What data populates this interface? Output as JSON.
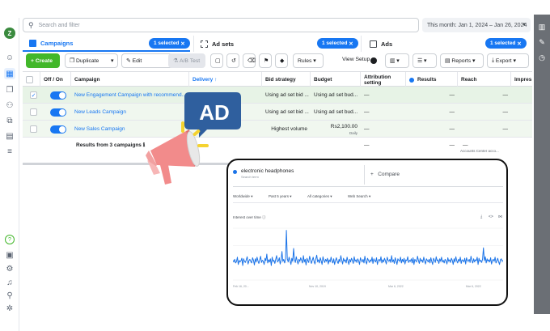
{
  "leftbar": {
    "avatar_initial": "Z",
    "icons": [
      "face-icon",
      "table-icon",
      "pages-icon",
      "people-icon",
      "stack-icon",
      "library-icon",
      "menu-icon",
      "help-icon",
      "image-icon",
      "settings-icon",
      "bell-icon",
      "search-icon",
      "bug-icon"
    ]
  },
  "rightbar": {
    "icons": [
      "chart-icon",
      "pencil-icon",
      "clock-icon"
    ]
  },
  "topbar": {
    "search_placeholder": "Search and filter",
    "date_range": "This month: Jan 1, 2024 – Jan 26, 2024"
  },
  "tabs": [
    {
      "label": "Campaigns",
      "badge": "1 selected",
      "active": true
    },
    {
      "label": "Ad sets",
      "badge": "1 selected",
      "active": false
    },
    {
      "label": "Ads",
      "badge": "1 selected",
      "active": false
    }
  ],
  "toolbar": {
    "create": "Create",
    "duplicate": "Duplicate",
    "edit": "Edit",
    "ab_test": "A/B Test",
    "rules": "Rules",
    "view_setup": "View Setup",
    "reports": "Reports",
    "export": "Export"
  },
  "table": {
    "headers": {
      "offon": "Off / On",
      "campaign": "Campaign",
      "delivery": "Delivery ↑",
      "bid": "Bid strategy",
      "budget": "Budget",
      "attribution": "Attribution setting",
      "results": "Results",
      "reach": "Reach",
      "impressions": "Impres"
    },
    "rows": [
      {
        "campaign": "New Engagement Campaign with recommend...",
        "bid": "Using ad set bid ...",
        "budget": "Using ad set bud...",
        "attribution": "—",
        "results": "—",
        "results_dash": "—",
        "reach": "—",
        "selected": true
      },
      {
        "campaign": "New Leads Campaign",
        "bid": "Using ad set bid ...",
        "budget": "Using ad set bud...",
        "attribution": "—",
        "results": "—",
        "results_dash": "—",
        "reach": "—",
        "selected": false
      },
      {
        "campaign": "New Sales Campaign",
        "bid": "Highest volume",
        "budget": "Rs2,100.00",
        "budget_sub": "Daily",
        "attribution": "—",
        "results": "—",
        "results_dash": "—",
        "reach": "—",
        "selected": false
      }
    ],
    "summary": {
      "label": "Results from 3 campaigns",
      "attribution": "—",
      "results": "—",
      "reach": "—",
      "reach_sub": "Accounts Center acco..."
    }
  },
  "promo": {
    "badge_text": "AD"
  },
  "trends": {
    "term": "electronic headphones",
    "term_sub": "Search term",
    "compare": "Compare",
    "filters": [
      "Worldwide",
      "Past 5 years",
      "All categories",
      "Web Search"
    ],
    "section_title": "Interest over time",
    "x_labels": [
      "Feb 16, 20...",
      "Nov 10, 2019",
      "Mar 6, 2022",
      "Mar 6, 2022"
    ],
    "chart_data": {
      "type": "line",
      "title": "Interest over time",
      "series": [
        {
          "values": [
            38,
            35,
            40,
            33,
            36,
            44,
            30,
            38,
            35,
            37,
            42,
            28,
            41,
            36,
            34,
            39,
            45,
            31,
            37,
            40,
            36,
            33,
            43,
            38,
            29,
            41,
            35,
            44,
            37,
            32,
            39,
            46,
            34,
            38,
            36,
            30,
            42,
            37,
            50,
            33,
            39,
            35,
            41,
            28,
            44,
            36,
            38,
            32,
            40,
            47,
            35,
            37,
            43,
            31,
            38,
            55,
            36,
            40,
            33,
            39,
            96,
            41,
            35,
            44,
            38,
            30,
            42,
            36,
            61,
            39,
            34,
            45,
            37,
            31,
            40,
            36,
            43,
            38,
            33,
            47,
            35,
            40,
            29,
            42,
            37,
            34,
            46,
            39,
            32,
            38,
            44,
            36,
            31,
            41,
            48,
            35,
            39,
            33,
            43,
            37,
            30,
            45,
            38,
            34,
            40,
            36,
            42,
            31,
            39,
            35,
            44,
            37,
            33,
            41,
            30,
            38,
            43,
            36,
            32,
            40,
            35,
            47,
            38,
            31,
            42,
            36,
            39,
            33,
            44,
            37,
            30,
            40,
            35,
            42,
            38,
            32,
            45,
            36,
            39,
            34,
            41,
            37,
            30,
            43,
            38,
            35,
            40,
            33,
            46,
            36,
            31,
            42,
            38,
            34,
            39,
            36,
            44,
            32,
            41,
            37,
            35,
            43,
            30,
            38,
            40,
            36,
            45,
            33,
            39,
            35,
            42,
            37,
            31,
            44,
            38,
            36,
            40,
            34,
            47,
            35,
            39,
            32,
            43,
            37,
            30,
            41,
            38,
            36,
            44,
            33,
            40,
            35,
            42,
            31,
            39,
            37,
            45,
            34,
            38,
            36,
            41,
            33,
            43,
            30,
            40,
            37,
            35,
            46,
            38,
            32,
            42,
            36,
            39,
            34,
            44,
            37,
            31,
            41,
            38,
            35,
            40,
            33,
            43,
            36,
            30,
            42,
            38,
            34,
            45,
            37,
            39,
            32,
            41,
            36,
            44,
            35,
            38,
            33,
            40,
            37,
            31,
            43,
            36,
            39,
            34,
            42,
            38,
            30,
            41,
            35,
            45,
            37,
            33,
            40,
            36,
            44,
            32,
            39,
            38,
            35,
            42,
            31,
            43,
            37,
            36,
            40,
            34,
            46,
            38,
            33,
            41,
            35,
            39,
            37,
            44,
            30,
            42,
            36,
            38,
            34,
            40,
            62,
            37,
            45,
            33,
            41,
            36,
            39,
            35,
            43,
            31,
            38,
            40,
            36,
            44,
            33,
            37,
            42,
            35,
            30,
            39,
            41,
            36,
            38
          ]
        }
      ],
      "ylim": [
        0,
        100
      ]
    }
  }
}
